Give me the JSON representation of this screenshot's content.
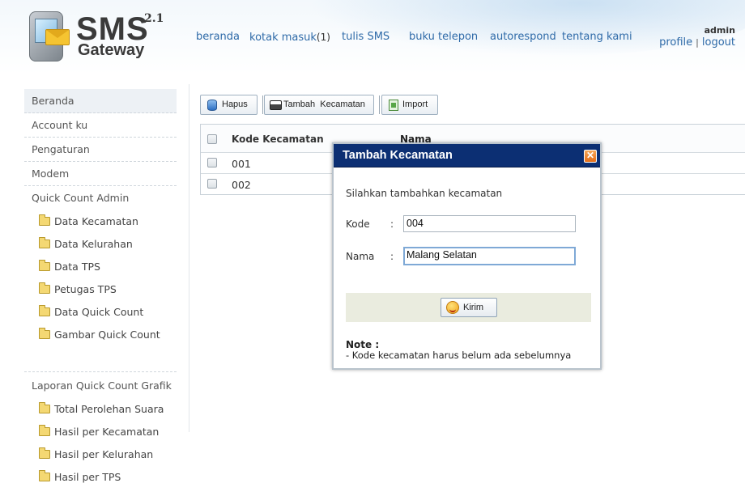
{
  "header": {
    "logo_sms": "SMS",
    "logo_gateway": "Gateway",
    "logo_version": "2.1",
    "nav": [
      {
        "label": "beranda"
      },
      {
        "label": "kotak masuk",
        "count": "(1)"
      },
      {
        "label": "tulis SMS"
      },
      {
        "label": "buku telepon"
      },
      {
        "label": "autorespond"
      },
      {
        "label": "tentang kami"
      }
    ],
    "user": "admin",
    "profile": "profile",
    "separator": "|",
    "logout": "logout"
  },
  "sidebar": {
    "items": [
      "Beranda",
      "Account ku",
      "Pengaturan",
      "Modem",
      "Quick Count Admin"
    ],
    "quick_count_admin": [
      "Data Kecamatan",
      "Data Kelurahan",
      "Data TPS",
      "Petugas TPS",
      "Data Quick Count",
      "Gambar Quick Count"
    ],
    "laporan_title": "Laporan Quick Count Grafik",
    "laporan": [
      "Total Perolehan Suara",
      "Hasil per Kecamatan",
      "Hasil per Kelurahan",
      "Hasil per TPS"
    ]
  },
  "toolbar": {
    "hapus": "Hapus",
    "tambah": "Tambah  Kecamatan",
    "import": "Import"
  },
  "table": {
    "headers": [
      "Kode Kecamatan",
      "Nama"
    ],
    "rows": [
      {
        "kode": "001"
      },
      {
        "kode": "002"
      }
    ]
  },
  "dialog": {
    "title": "Tambah Kecamatan",
    "close": "✕",
    "intro": "Silahkan tambahkan kecamatan",
    "kode_label": "Kode",
    "nama_label": "Nama",
    "colon": ":",
    "kode_value": "004",
    "nama_value": "Malang Selatan",
    "submit": "Kirim",
    "note_title": "Note :",
    "note_text": "- Kode kecamatan harus belum ada sebelumnya"
  },
  "colors": {
    "dialog_title_bg": "#0c2f73",
    "link": "#2e6aa8",
    "close_button": "#e56d17"
  }
}
